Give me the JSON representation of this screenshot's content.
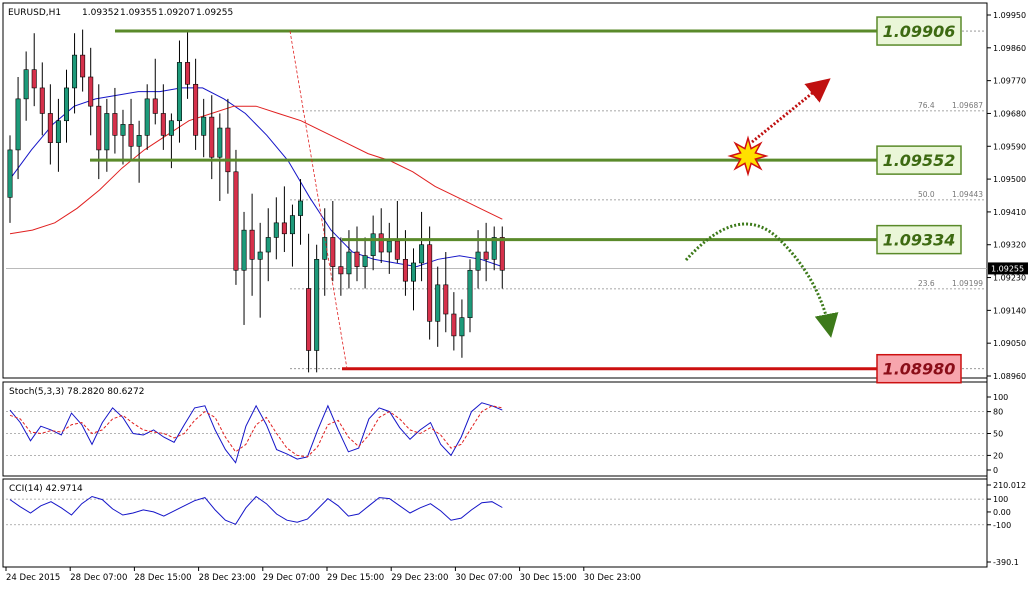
{
  "chart_data": [
    {
      "type": "candlestick",
      "symbol": "EURUSD,H1",
      "ohlc_readout": [
        "1.09352",
        "1.09355",
        "1.09207",
        "1.09255"
      ],
      "current_price": "1.09255",
      "ylim": [
        1.0896,
        1.0995
      ],
      "y_ticks": [
        "1.09950",
        "1.09860",
        "1.09770",
        "1.09680",
        "1.09590",
        "1.09500",
        "1.09410",
        "1.09320",
        "1.09230",
        "1.09140",
        "1.09050",
        "1.08960"
      ],
      "x_ticks": [
        "24 Dec 2015",
        "28 Dec 07:00",
        "28 Dec 15:00",
        "28 Dec 23:00",
        "29 Dec 07:00",
        "29 Dec 15:00",
        "29 Dec 23:00",
        "30 Dec 07:00",
        "30 Dec 15:00",
        "30 Dec 23:00"
      ],
      "colors": {
        "bull": "#1d9a7a",
        "bear": "#d6314b",
        "ma_fast": "#1515c8",
        "ma_slow": "#e02020",
        "support_resistance": "#5a8a2a",
        "label_green_bg": "#eaf6d8",
        "label_red_bg": "#f7a5ad"
      },
      "levels": [
        {
          "price": 1.09906,
          "label": "1.09906",
          "kind": "resistance"
        },
        {
          "price": 1.09552,
          "label": "1.09552",
          "kind": "resistance"
        },
        {
          "price": 1.09334,
          "label": "1.09334",
          "kind": "pivot"
        },
        {
          "price": 1.0898,
          "label": "1.08980",
          "kind": "support"
        }
      ],
      "fibonacci": [
        {
          "ratio": "76.4",
          "price": "1.09687"
        },
        {
          "ratio": "50.0",
          "price": "1.09443"
        },
        {
          "ratio": "23.6",
          "price": "1.09199"
        }
      ],
      "candles": [
        {
          "o": 1.0945,
          "h": 1.0962,
          "l": 1.0938,
          "c": 1.0958
        },
        {
          "o": 1.0958,
          "h": 1.0978,
          "l": 1.095,
          "c": 1.0972
        },
        {
          "o": 1.0972,
          "h": 1.0985,
          "l": 1.0966,
          "c": 1.098
        },
        {
          "o": 1.098,
          "h": 1.099,
          "l": 1.097,
          "c": 1.0975
        },
        {
          "o": 1.0975,
          "h": 1.0982,
          "l": 1.0962,
          "c": 1.0968
        },
        {
          "o": 1.0968,
          "h": 1.0976,
          "l": 1.0954,
          "c": 1.096
        },
        {
          "o": 1.096,
          "h": 1.0972,
          "l": 1.0952,
          "c": 1.0966
        },
        {
          "o": 1.0966,
          "h": 1.098,
          "l": 1.096,
          "c": 1.0975
        },
        {
          "o": 1.0975,
          "h": 1.099,
          "l": 1.0968,
          "c": 1.0984
        },
        {
          "o": 1.0984,
          "h": 1.0991,
          "l": 1.0974,
          "c": 1.0978
        },
        {
          "o": 1.0978,
          "h": 1.0986,
          "l": 1.0962,
          "c": 1.097
        },
        {
          "o": 1.097,
          "h": 1.0976,
          "l": 1.095,
          "c": 1.0958
        },
        {
          "o": 1.0958,
          "h": 1.0972,
          "l": 1.0952,
          "c": 1.0968
        },
        {
          "o": 1.0968,
          "h": 1.0975,
          "l": 1.0957,
          "c": 1.0962
        },
        {
          "o": 1.0962,
          "h": 1.0969,
          "l": 1.0954,
          "c": 1.0965
        },
        {
          "o": 1.0965,
          "h": 1.0972,
          "l": 1.0955,
          "c": 1.0959
        },
        {
          "o": 1.0959,
          "h": 1.0966,
          "l": 1.0949,
          "c": 1.0962
        },
        {
          "o": 1.0962,
          "h": 1.0976,
          "l": 1.0958,
          "c": 1.0972
        },
        {
          "o": 1.0972,
          "h": 1.0983,
          "l": 1.0965,
          "c": 1.0968
        },
        {
          "o": 1.0968,
          "h": 1.0976,
          "l": 1.0958,
          "c": 1.0962
        },
        {
          "o": 1.0962,
          "h": 1.0968,
          "l": 1.0953,
          "c": 1.0966
        },
        {
          "o": 1.0966,
          "h": 1.0988,
          "l": 1.096,
          "c": 1.0982
        },
        {
          "o": 1.0982,
          "h": 1.0991,
          "l": 1.0972,
          "c": 1.0976
        },
        {
          "o": 1.0976,
          "h": 1.0983,
          "l": 1.0958,
          "c": 1.0962
        },
        {
          "o": 1.0962,
          "h": 1.0972,
          "l": 1.0956,
          "c": 1.0967
        },
        {
          "o": 1.0967,
          "h": 1.0973,
          "l": 1.095,
          "c": 1.0956
        },
        {
          "o": 1.0956,
          "h": 1.0968,
          "l": 1.0944,
          "c": 1.0964
        },
        {
          "o": 1.0964,
          "h": 1.0972,
          "l": 1.0946,
          "c": 1.0952
        },
        {
          "o": 1.0952,
          "h": 1.0958,
          "l": 1.0921,
          "c": 1.0925
        },
        {
          "o": 1.0925,
          "h": 1.0941,
          "l": 1.091,
          "c": 1.0936
        },
        {
          "o": 1.0936,
          "h": 1.0946,
          "l": 1.0918,
          "c": 1.0928
        },
        {
          "o": 1.0928,
          "h": 1.0938,
          "l": 1.0912,
          "c": 1.093
        },
        {
          "o": 1.093,
          "h": 1.0942,
          "l": 1.0922,
          "c": 1.0934
        },
        {
          "o": 1.0934,
          "h": 1.0945,
          "l": 1.0928,
          "c": 1.0938
        },
        {
          "o": 1.0938,
          "h": 1.0948,
          "l": 1.093,
          "c": 1.0935
        },
        {
          "o": 1.0935,
          "h": 1.0943,
          "l": 1.0926,
          "c": 1.094
        },
        {
          "o": 1.094,
          "h": 1.095,
          "l": 1.0932,
          "c": 1.0944
        }
      ],
      "candles_post_drop": [
        {
          "o": 1.092,
          "h": 1.0935,
          "l": 1.0897,
          "c": 1.0903
        },
        {
          "o": 1.0903,
          "h": 1.0932,
          "l": 1.0897,
          "c": 1.0928
        },
        {
          "o": 1.0928,
          "h": 1.0942,
          "l": 1.0918,
          "c": 1.0934
        },
        {
          "o": 1.0934,
          "h": 1.0944,
          "l": 1.0922,
          "c": 1.0926
        },
        {
          "o": 1.0926,
          "h": 1.0934,
          "l": 1.0918,
          "c": 1.0924
        },
        {
          "o": 1.0924,
          "h": 1.0936,
          "l": 1.092,
          "c": 1.093
        },
        {
          "o": 1.093,
          "h": 1.0937,
          "l": 1.0922,
          "c": 1.0926
        },
        {
          "o": 1.0926,
          "h": 1.0934,
          "l": 1.092,
          "c": 1.0929
        },
        {
          "o": 1.0929,
          "h": 1.094,
          "l": 1.0925,
          "c": 1.0935
        },
        {
          "o": 1.0935,
          "h": 1.0942,
          "l": 1.0927,
          "c": 1.093
        },
        {
          "o": 1.093,
          "h": 1.0938,
          "l": 1.0924,
          "c": 1.0933
        },
        {
          "o": 1.0933,
          "h": 1.0944,
          "l": 1.0927,
          "c": 1.0928
        },
        {
          "o": 1.0928,
          "h": 1.0936,
          "l": 1.0918,
          "c": 1.0922
        },
        {
          "o": 1.0922,
          "h": 1.0931,
          "l": 1.0914,
          "c": 1.0927
        },
        {
          "o": 1.0927,
          "h": 1.0941,
          "l": 1.0922,
          "c": 1.0932
        },
        {
          "o": 1.0932,
          "h": 1.0937,
          "l": 1.0906,
          "c": 1.0911
        },
        {
          "o": 1.0911,
          "h": 1.0926,
          "l": 1.0904,
          "c": 1.0921
        },
        {
          "o": 1.0921,
          "h": 1.093,
          "l": 1.0908,
          "c": 1.0913
        },
        {
          "o": 1.0913,
          "h": 1.0919,
          "l": 1.0903,
          "c": 1.0907
        },
        {
          "o": 1.0907,
          "h": 1.0917,
          "l": 1.0901,
          "c": 1.0912
        },
        {
          "o": 1.0912,
          "h": 1.0928,
          "l": 1.0908,
          "c": 1.0925
        },
        {
          "o": 1.0925,
          "h": 1.0936,
          "l": 1.092,
          "c": 1.093
        },
        {
          "o": 1.093,
          "h": 1.0938,
          "l": 1.0922,
          "c": 1.0928
        },
        {
          "o": 1.0928,
          "h": 1.0937,
          "l": 1.0925,
          "c": 1.0934
        },
        {
          "o": 1.0934,
          "h": 1.0937,
          "l": 1.092,
          "c": 1.0925
        }
      ],
      "ma_fast": [
        1.095,
        1.0958,
        1.0965,
        1.097,
        1.0972,
        1.0973,
        1.0974,
        1.0974,
        1.0975,
        1.0975,
        1.0972,
        1.0968,
        1.0962,
        1.0955,
        1.0945,
        1.0936,
        1.093,
        1.0928,
        1.0927,
        1.0926,
        1.0928,
        1.0929,
        1.0928,
        1.0926
      ],
      "ma_slow": [
        1.0935,
        1.0936,
        1.0938,
        1.0942,
        1.0947,
        1.0953,
        1.0958,
        1.0962,
        1.0966,
        1.0968,
        1.097,
        1.097,
        1.0968,
        1.0966,
        1.0963,
        1.096,
        1.0957,
        1.0955,
        1.0952,
        1.0948,
        1.0945,
        1.0942,
        1.0939
      ]
    },
    {
      "type": "line",
      "title": "Stoch(5,3,3) 78.2820 80.6272",
      "ylim": [
        0,
        100
      ],
      "y_ticks": [
        "100",
        "80",
        "50",
        "20",
        "0"
      ],
      "series": [
        {
          "values": [
            82,
            65,
            40,
            60,
            55,
            48,
            78,
            62,
            35,
            65,
            85,
            72,
            50,
            48,
            55,
            45,
            38,
            62,
            85,
            88,
            55,
            28,
            10,
            60,
            88,
            62,
            28,
            22,
            15,
            18,
            55,
            88,
            55,
            25,
            30,
            70,
            85,
            80,
            58,
            42,
            55,
            65,
            35,
            20,
            45,
            80,
            92,
            88,
            82
          ]
        },
        {
          "values": [
            75,
            70,
            52,
            50,
            54,
            52,
            62,
            65,
            50,
            55,
            70,
            75,
            64,
            55,
            52,
            50,
            44,
            50,
            68,
            80,
            72,
            45,
            25,
            35,
            62,
            72,
            50,
            30,
            20,
            18,
            32,
            62,
            68,
            45,
            32,
            48,
            72,
            80,
            70,
            55,
            50,
            58,
            48,
            30,
            35,
            58,
            80,
            88,
            85
          ]
        }
      ]
    },
    {
      "type": "line",
      "title": "CCI(14) 42.9714",
      "ylim": [
        -390.1,
        210.0
      ],
      "y_ticks": [
        "210.012",
        "100",
        "0.00",
        "-100",
        "-390.1"
      ],
      "series": [
        {
          "values": [
            120,
            50,
            -10,
            60,
            100,
            40,
            -30,
            80,
            150,
            120,
            30,
            -30,
            -10,
            20,
            0,
            -40,
            10,
            60,
            110,
            140,
            20,
            -80,
            -120,
            40,
            150,
            80,
            -20,
            -80,
            -100,
            -70,
            30,
            130,
            60,
            -40,
            -20,
            60,
            140,
            130,
            60,
            -10,
            40,
            80,
            10,
            -80,
            -60,
            20,
            90,
            100,
            43
          ]
        }
      ]
    }
  ]
}
